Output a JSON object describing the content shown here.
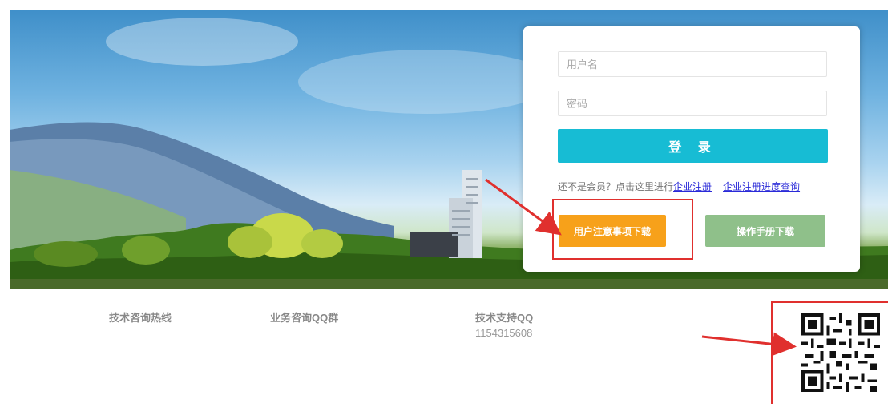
{
  "login": {
    "username_placeholder": "用户名",
    "password_placeholder": "密码",
    "login_button": "登 录",
    "register_prompt": "还不是会员？点击这里进行",
    "register_link": "企业注册",
    "progress_link": "企业注册进度查询",
    "notice_download": "用户注意事项下载",
    "manual_download": "操作手册下载"
  },
  "footer": {
    "hotline_label": "技术咨询热线",
    "qq_group_label": "业务咨询QQ群",
    "support_qq_label": "技术支持QQ",
    "support_qq_value": "1154315608"
  },
  "colors": {
    "login_button": "#17bcd4",
    "notice_button": "#f7a11a",
    "manual_button": "#8fc08a",
    "link": "#2a2ad8",
    "annotation": "#e0302e"
  }
}
